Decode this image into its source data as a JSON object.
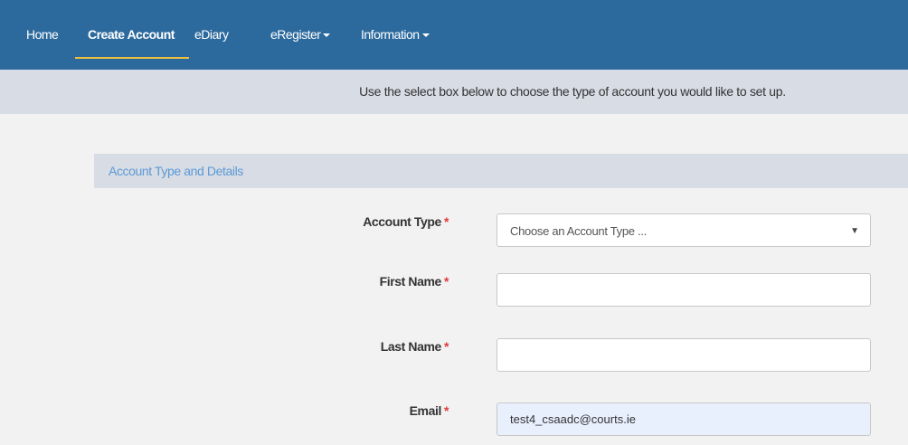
{
  "nav": {
    "items": [
      {
        "label": "Home"
      },
      {
        "label": "Create Account"
      },
      {
        "label": "eDiary"
      },
      {
        "label": "eRegister"
      },
      {
        "label": "Information"
      }
    ]
  },
  "banner": {
    "text": "Use the select box below to choose the type of account you would like to set up."
  },
  "section": {
    "title": "Account Type and Details"
  },
  "form": {
    "required_marker": "*",
    "account_type": {
      "label": "Account Type",
      "selected": "Choose an Account Type ...",
      "arrow": "▼"
    },
    "first_name": {
      "label": "First Name",
      "value": ""
    },
    "last_name": {
      "label": "Last Name",
      "value": ""
    },
    "email": {
      "label": "Email",
      "value": "test4_csaadc@courts.ie"
    }
  },
  "colors": {
    "navbar": "#2c6a9e",
    "active_underline": "#f0c040",
    "banner": "#d8dce4",
    "section_title": "#5b9ad6",
    "required": "#e03b3b",
    "autofill": "#e8f0fe"
  }
}
